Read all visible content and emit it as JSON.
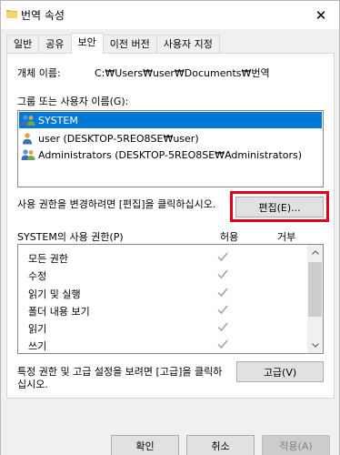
{
  "window": {
    "title": "번역 속성",
    "close_glyph": "✕"
  },
  "tabs": [
    {
      "label": "일반",
      "active": false
    },
    {
      "label": "공유",
      "active": false
    },
    {
      "label": "보안",
      "active": true
    },
    {
      "label": "이전 버전",
      "active": false
    },
    {
      "label": "사용자 지정",
      "active": false
    }
  ],
  "security": {
    "object_name_label": "개체 이름:",
    "object_name_value": "C:₩Users₩user₩Documents₩번역",
    "group_label": "그룹 또는 사용자 이름(G):",
    "groups": [
      {
        "name": "SYSTEM",
        "selected": true,
        "icon": "users-group-icon"
      },
      {
        "name": "user (DESKTOP-5REO8SE₩user)",
        "selected": false,
        "icon": "user-icon"
      },
      {
        "name": "Administrators (DESKTOP-5REO8SE₩Administrators)",
        "selected": false,
        "icon": "users-group-icon"
      }
    ],
    "edit_hint": "사용 권한을 변경하려면 [편집]을 클릭하십시오.",
    "edit_button": "편집(E)...",
    "perm_label": "SYSTEM의 사용 권한(P)",
    "allow_header": "허용",
    "deny_header": "거부",
    "permissions": [
      {
        "name": "모든 권한",
        "allow": true,
        "deny": false
      },
      {
        "name": "수정",
        "allow": true,
        "deny": false
      },
      {
        "name": "읽기 및 실행",
        "allow": true,
        "deny": false
      },
      {
        "name": "폴더 내용 보기",
        "allow": true,
        "deny": false
      },
      {
        "name": "읽기",
        "allow": true,
        "deny": false
      },
      {
        "name": "쓰기",
        "allow": true,
        "deny": false
      }
    ],
    "advanced_hint_line1": "특정 권한 및 고급 설정을 보려면 [고급]을 클릭하",
    "advanced_hint_line2": "십시오.",
    "advanced_button": "고급(V)"
  },
  "footer": {
    "ok": "확인",
    "cancel": "취소",
    "apply": "적용(A)"
  },
  "colors": {
    "selection": "#0078d7",
    "highlight_box": "#e0001b",
    "checkmark": "#a0a0a0"
  }
}
